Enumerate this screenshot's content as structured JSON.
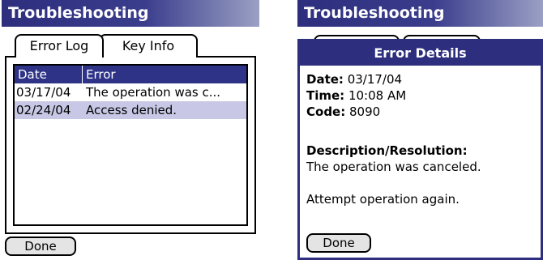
{
  "left": {
    "title": "Troubleshooting",
    "tabs": [
      {
        "label": "Error Log",
        "active": true
      },
      {
        "label": "Key Info",
        "active": false
      }
    ],
    "log": {
      "columns": [
        "Date",
        "Error"
      ],
      "rows": [
        {
          "date": "03/17/04",
          "error": "The operation was c..."
        },
        {
          "date": "02/24/04",
          "error": "Access denied.",
          "selected": true
        }
      ]
    },
    "done_label": "Done"
  },
  "right": {
    "title": "Troubleshooting",
    "dialog": {
      "title": "Error Details",
      "date_label": "Date:",
      "date_value": "03/17/04",
      "time_label": "Time:",
      "time_value": "10:08 AM",
      "code_label": "Code:",
      "code_value": "8090",
      "desc_heading": "Description/Resolution:",
      "desc_text": "The operation was canceled.",
      "resolution_text": "Attempt operation again.",
      "done_label": "Done"
    }
  },
  "colors": {
    "titlebar": "#2d2f7e",
    "header": "#2e3388",
    "selected_row": "#c8c8e6"
  }
}
